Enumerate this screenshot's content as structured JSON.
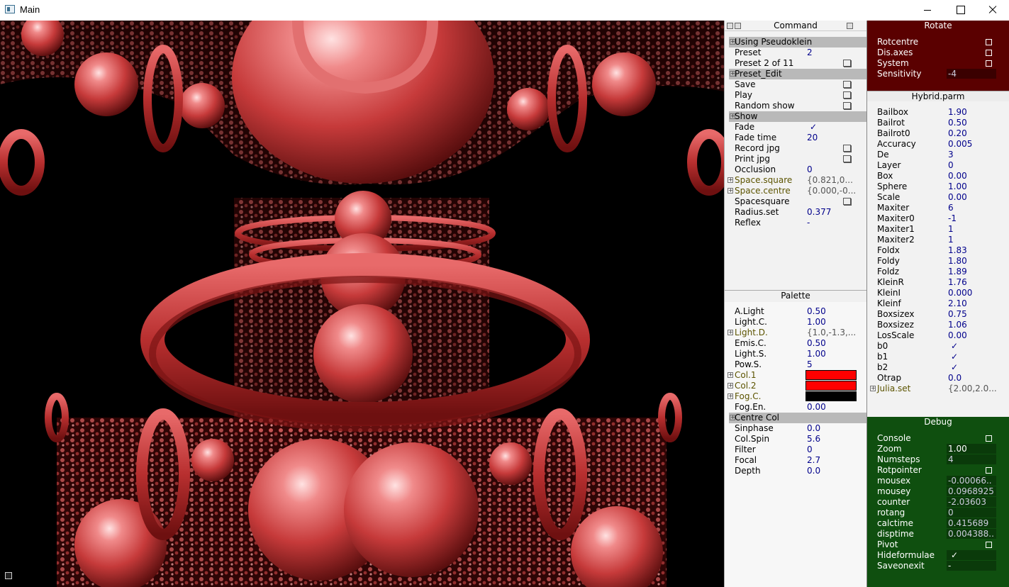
{
  "window": {
    "title": "Main"
  },
  "colors": {
    "fractal_red": "#c83b3b",
    "rotate_bg": "#5a0000",
    "debug_bg": "#0f4f0f",
    "value_blue": "#00008b",
    "swatch_red": "#ff0000",
    "swatch_black": "#000000"
  },
  "icons": {
    "app": "app-icon",
    "minimize": "minimize-icon",
    "maximize": "maximize-icon",
    "close": "close-icon",
    "checkmark": "✓",
    "expand": "+"
  },
  "command": {
    "title": "Command",
    "rows": [
      {
        "label": "Using Pseudoklein",
        "kind": "header"
      },
      {
        "label": "Preset",
        "value": "2"
      },
      {
        "label": "Preset 2 of 11",
        "kind": "button"
      },
      {
        "label": "Preset_Edit",
        "kind": "header"
      },
      {
        "label": "Save",
        "kind": "button"
      },
      {
        "label": "Play",
        "kind": "button"
      },
      {
        "label": "Random show",
        "kind": "button"
      },
      {
        "label": "Show",
        "kind": "header"
      },
      {
        "label": "Fade",
        "kind": "tick",
        "value": "✓"
      },
      {
        "label": "Fade time",
        "value": "20"
      },
      {
        "label": "Record jpg",
        "kind": "button"
      },
      {
        "label": "Print jpg",
        "kind": "button"
      },
      {
        "label": "Occlusion",
        "value": "0"
      },
      {
        "label": "Space.square",
        "value": "{0.821,0...",
        "kind": "group"
      },
      {
        "label": "Space.centre",
        "value": "{0.000,-0...",
        "kind": "group"
      },
      {
        "label": "Spacesquare",
        "kind": "button"
      },
      {
        "label": "Radius.set",
        "value": "0.377"
      },
      {
        "label": "Reflex",
        "value": "-"
      }
    ]
  },
  "palette": {
    "title": "Palette",
    "rows": [
      {
        "label": "A.Light",
        "value": "0.50"
      },
      {
        "label": "Light.C.",
        "value": "1.00"
      },
      {
        "label": "Light.D.",
        "value": "{1.0,-1.3,...",
        "kind": "group"
      },
      {
        "label": "Emis.C.",
        "value": "0.50"
      },
      {
        "label": "Light.S.",
        "value": "1.00"
      },
      {
        "label": "Pow.S.",
        "value": "5"
      },
      {
        "label": "Col.1",
        "kind": "swatch",
        "color": "#ff0000"
      },
      {
        "label": "Col.2",
        "kind": "swatch",
        "color": "#ff0000"
      },
      {
        "label": "Fog.C.",
        "kind": "swatch",
        "color": "#000000"
      },
      {
        "label": "Fog.En.",
        "value": "0.00"
      },
      {
        "label": "Centre Col",
        "kind": "header"
      },
      {
        "label": "Sinphase",
        "value": "0.0"
      },
      {
        "label": "Col.Spin",
        "value": "5.6"
      },
      {
        "label": "Filter",
        "value": "0"
      },
      {
        "label": "Focal",
        "value": "2.7"
      },
      {
        "label": "Depth",
        "value": "0.0"
      }
    ]
  },
  "rotate": {
    "title": "Rotate",
    "rows": [
      {
        "label": "Rotcentre",
        "kind": "check"
      },
      {
        "label": "Dis.axes",
        "kind": "check"
      },
      {
        "label": "System",
        "kind": "check"
      },
      {
        "label": "Sensitivity",
        "value": "-4"
      }
    ]
  },
  "hybrid": {
    "title": "Hybrid.parm",
    "rows": [
      {
        "label": "Bailbox",
        "value": "1.90"
      },
      {
        "label": "Bailrot",
        "value": "0.50"
      },
      {
        "label": "Bailrot0",
        "value": "0.20"
      },
      {
        "label": "Accuracy",
        "value": "0.005"
      },
      {
        "label": "De",
        "value": "3"
      },
      {
        "label": "Layer",
        "value": "0"
      },
      {
        "label": "Box",
        "value": "0.00"
      },
      {
        "label": "Sphere",
        "value": "1.00"
      },
      {
        "label": "Scale",
        "value": "0.00"
      },
      {
        "label": "Maxiter",
        "value": "6"
      },
      {
        "label": "Maxiter0",
        "value": "-1"
      },
      {
        "label": "Maxiter1",
        "value": "1"
      },
      {
        "label": "Maxiter2",
        "value": "1"
      },
      {
        "label": "Foldx",
        "value": "1.83"
      },
      {
        "label": "Foldy",
        "value": "1.80"
      },
      {
        "label": "Foldz",
        "value": "1.89"
      },
      {
        "label": "KleinR",
        "value": "1.76"
      },
      {
        "label": "KleinI",
        "value": "0.000"
      },
      {
        "label": "Kleinf",
        "value": "2.10"
      },
      {
        "label": "Boxsizex",
        "value": "0.75"
      },
      {
        "label": "Boxsizez",
        "value": "1.06"
      },
      {
        "label": "LosScale",
        "value": "0.00"
      },
      {
        "label": "b0",
        "kind": "tick",
        "value": "✓"
      },
      {
        "label": "b1",
        "kind": "tick",
        "value": "✓"
      },
      {
        "label": "b2",
        "kind": "tick",
        "value": "✓"
      },
      {
        "label": "Otrap",
        "value": "0.0"
      },
      {
        "label": "Julia.set",
        "value": "{2.00,2.0...",
        "kind": "group"
      }
    ]
  },
  "debug": {
    "title": "Debug",
    "rows": [
      {
        "label": "Console",
        "kind": "check"
      },
      {
        "label": "Zoom",
        "value": "1.00"
      },
      {
        "label": "Numsteps",
        "value": "4",
        "num": true
      },
      {
        "label": "Rotpointer",
        "kind": "check"
      },
      {
        "label": "mousex",
        "value": "-0.00066..",
        "num": true
      },
      {
        "label": "mousey",
        "value": "0.0968925",
        "num": true
      },
      {
        "label": "counter",
        "value": "-2.03603",
        "num": true
      },
      {
        "label": "rotang",
        "value": "0",
        "num": true
      },
      {
        "label": "calctime",
        "value": "0.415689",
        "num": true
      },
      {
        "label": "disptime",
        "value": "0.004388..",
        "num": true
      },
      {
        "label": "Pivot",
        "kind": "check"
      },
      {
        "label": "Hideformulae",
        "kind": "tick",
        "value": "✓"
      },
      {
        "label": "Saveonexit",
        "value": "-"
      }
    ]
  }
}
